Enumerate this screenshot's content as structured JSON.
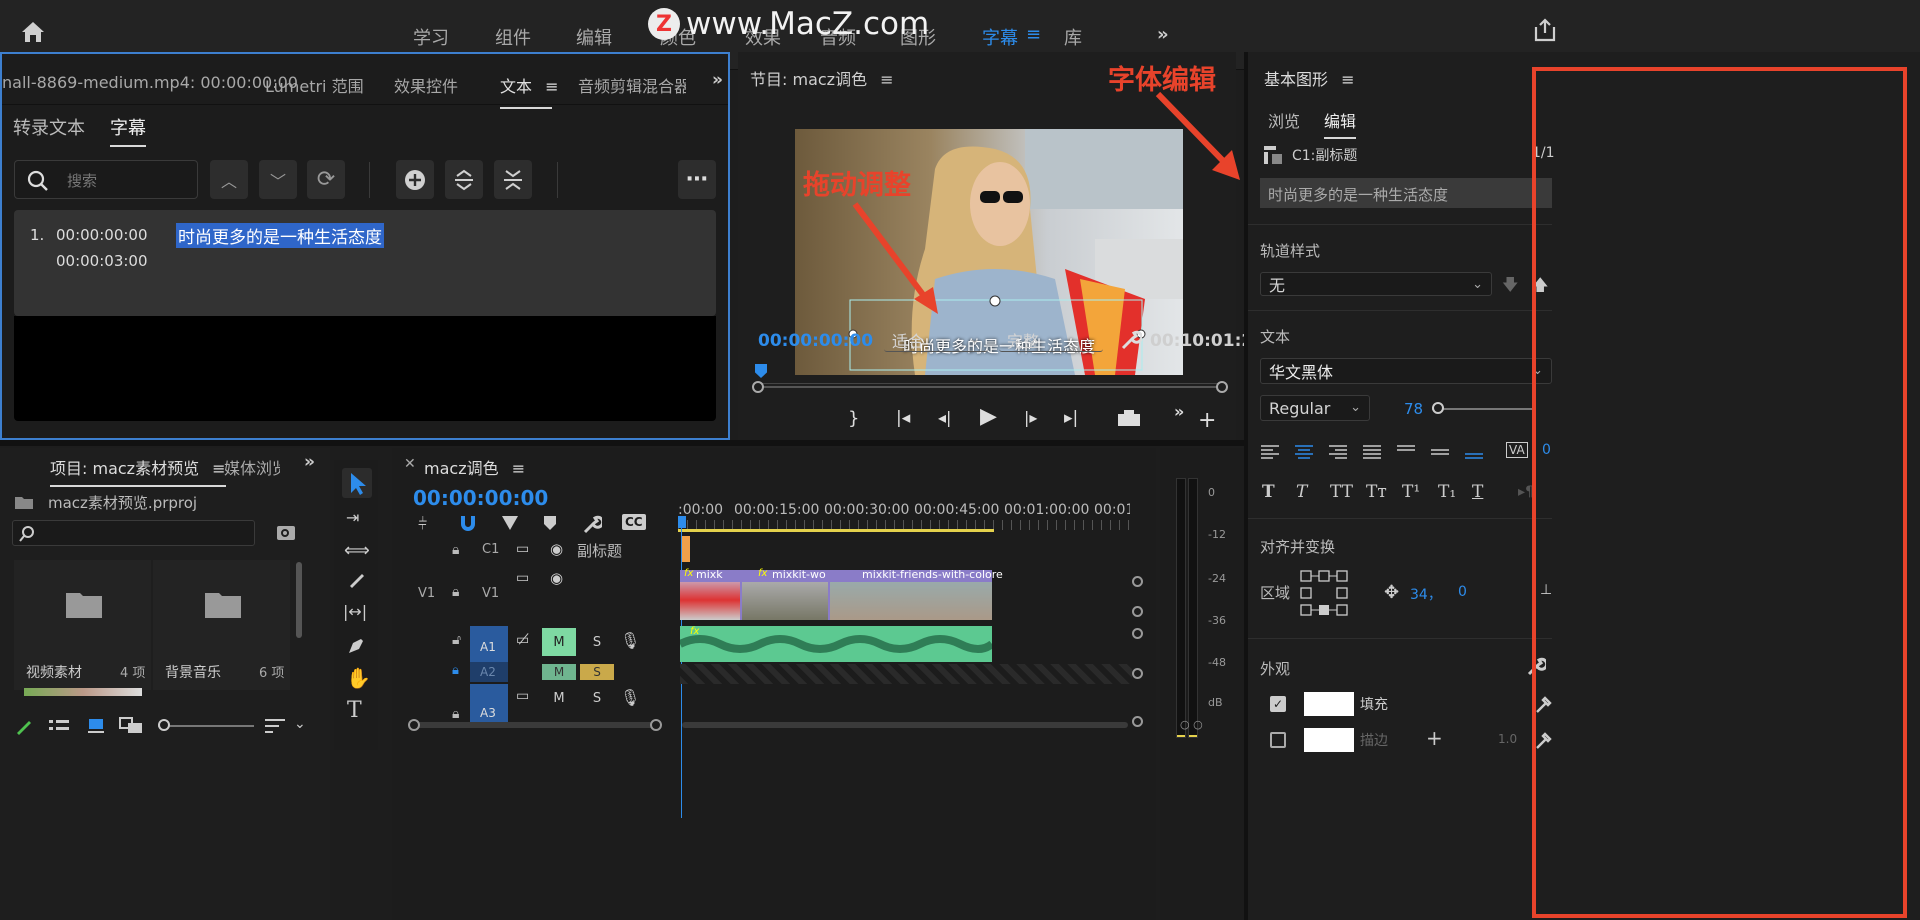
{
  "watermark": "www.MacZ.com",
  "workspace_tabs": [
    "学习",
    "组件",
    "编辑",
    "颜色",
    "效果",
    "音频",
    "图形",
    "字幕",
    "库"
  ],
  "active_workspace": "字幕",
  "source_panel": {
    "tabs": [
      "nall-8869-medium.mp4: 00:00:00:00",
      "Lumetri 范围",
      "效果控件",
      "文本",
      "音频剪辑混合器:"
    ],
    "subtabs": [
      "转录文本",
      "字幕"
    ],
    "search_placeholder": "搜索",
    "caption": {
      "index": "1.",
      "in": "00:00:00:00",
      "out": "00:00:03:00",
      "text": "时尚更多的是一种生活态度"
    }
  },
  "program": {
    "title": "节目: macz调色",
    "caption_overlay": "时尚更多的是一种生活态度",
    "annotation": "拖动调整",
    "timecode": "00:00:00:00",
    "fit": "适合",
    "quality": "完整",
    "duration": "00:10:01:2"
  },
  "annotation_font": "字体编辑",
  "project": {
    "tabs": [
      "项目: macz素材预览",
      "媒体浏览"
    ],
    "filename": "macz素材预览.prproj",
    "bins": [
      {
        "name": "视频素材",
        "count": "4 项"
      },
      {
        "name": "背景音乐",
        "count": "6 项"
      }
    ]
  },
  "timeline": {
    "title": "macz调色",
    "timecode": "00:00:00:00",
    "ruler": [
      ":00:00",
      "00:00:15:00",
      "00:00:30:00",
      "00:00:45:00",
      "00:01:00:00",
      "00:01:1"
    ],
    "tracks": [
      {
        "src": "",
        "name": "C1",
        "label": "副标题"
      },
      {
        "src": "V1",
        "name": "V1",
        "label": ""
      },
      {
        "src": "",
        "name": "A1",
        "m": "M",
        "s": "S"
      },
      {
        "src": "",
        "name": "A2",
        "m": "M",
        "s": "S"
      },
      {
        "src": "",
        "name": "A3",
        "m": "M",
        "s": "S"
      }
    ],
    "clips": [
      "mixk",
      "mixkit-wo",
      "mixkit-friends-with-colore"
    ],
    "fx": "fx"
  },
  "meter": {
    "scale": [
      "0",
      "-12",
      "-24",
      "-36",
      "-48",
      "dB"
    ]
  },
  "essential_graphics": {
    "title": "基本图形",
    "tabs": [
      "浏览",
      "编辑"
    ],
    "layer": "C1:副标题",
    "layer_count": "1/1",
    "text_value": "时尚更多的是一种生活态度",
    "track_style_label": "轨道样式",
    "track_style": "无",
    "text_label": "文本",
    "font": "华文黑体",
    "weight": "Regular",
    "size": "78",
    "kerning": "0",
    "align_label": "对齐并变换",
    "region_label": "区域",
    "position": [
      "34，",
      "0"
    ],
    "appearance_label": "外观",
    "fill_label": "填充",
    "stroke_label": "描边",
    "stroke_value": "1.0",
    "style_buttons": [
      "T",
      "T",
      "TT",
      "Tт",
      "T¹",
      "T₁",
      "T"
    ]
  },
  "colors": {
    "accent": "#2d8ceb",
    "annotation": "#e8432b",
    "caption_green": "#65d7a0"
  }
}
